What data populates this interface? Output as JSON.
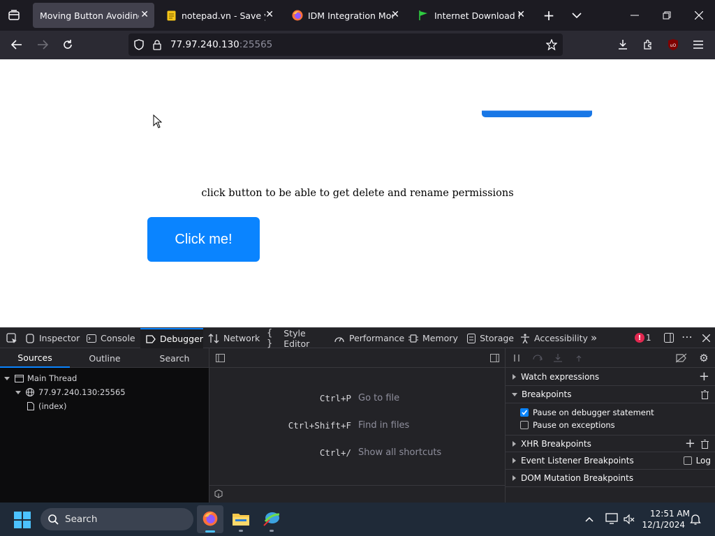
{
  "browser": {
    "tabs": [
      {
        "title": "Moving Button Avoiding M",
        "active": true
      },
      {
        "title": "notepad.vn - Save your",
        "icon": "notepad-icon"
      },
      {
        "title": "IDM Integration Module",
        "icon": "firefox-icon"
      },
      {
        "title": "Internet Download Mar",
        "icon": "green-flag-icon"
      }
    ],
    "url_host": "77.97.240.130",
    "url_port": ":25565"
  },
  "page": {
    "message": "click button to be able to get delete and rename permissions",
    "button_label": "Click me!"
  },
  "devtools": {
    "tabs": [
      "Inspector",
      "Console",
      "Debugger",
      "Network",
      "Style Editor",
      "Performance",
      "Memory",
      "Storage",
      "Accessibility"
    ],
    "active_tab": "Debugger",
    "error_count": "1",
    "left_tabs": [
      "Sources",
      "Outline",
      "Search"
    ],
    "tree": {
      "main_thread": "Main Thread",
      "host": "77.97.240.130:25565",
      "file": "(index)"
    },
    "shortcuts": [
      {
        "key": "Ctrl+P",
        "desc": "Go to file"
      },
      {
        "key": "Ctrl+Shift+F",
        "desc": "Find in files"
      },
      {
        "key": "Ctrl+/",
        "desc": "Show all shortcuts"
      }
    ],
    "right": {
      "watch": "Watch expressions",
      "breakpoints": "Breakpoints",
      "pause_debugger": "Pause on debugger statement",
      "pause_exceptions": "Pause on exceptions",
      "xhr": "XHR Breakpoints",
      "event_listener": "Event Listener Breakpoints",
      "log": "Log",
      "dom_mutation": "DOM Mutation Breakpoints"
    }
  },
  "taskbar": {
    "search_placeholder": "Search",
    "time": "12:51 AM",
    "date": "12/1/2024"
  },
  "colors": {
    "accent": "#0a84ff",
    "taskbar": "#1f2a38"
  }
}
